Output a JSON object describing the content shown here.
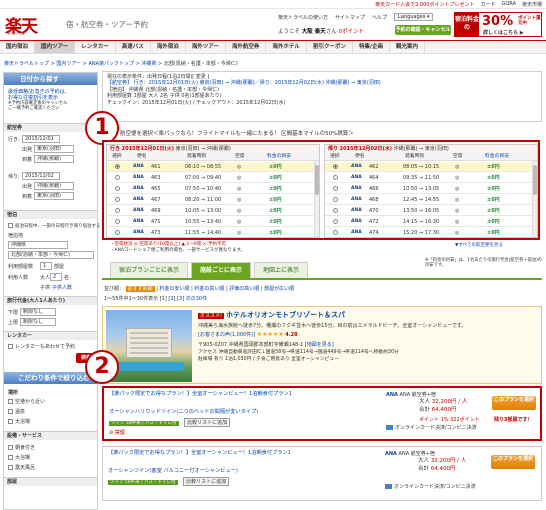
{
  "topbar": {
    "links": [
      "楽天カード入会で2,000ポイントプレゼント",
      "カード",
      "GORA",
      "楽天市場"
    ]
  },
  "header": {
    "logo": "楽天",
    "logo_sub": "トラベル",
    "tagline": "宿・航空券・ツアー予約",
    "links": [
      "楽天トラベルの使い方",
      "サイトマップ",
      "ヘルプ",
      "Languages ▾"
    ],
    "greeting_prefix": "ようこそ",
    "user_name": "大阪 楽天",
    "greeting_suffix": "さん",
    "points": "0ポイント",
    "reserve_button": "予約の確認・キャンセル",
    "campaign": {
      "label": "宿泊料金の",
      "percent": "30%",
      "suffix": "ポイント還元中",
      "detail": "詳しくはこちら ▶"
    }
  },
  "nav": {
    "items": [
      "国内宿泊",
      "国内ツアー",
      "レンタカー",
      "高速バス",
      "海外宿泊",
      "海外ツアー",
      "海外航空券",
      "海外ホテル",
      "割引クーポン",
      "特集/企画",
      "観光案内"
    ],
    "active": 1
  },
  "breadcrumb": [
    "楽天トラベルトップ",
    "国内ツアー",
    "ANA楽パックトップ",
    "沖縄県",
    "北部(恩納・名護・本部・今帰仁)"
  ],
  "sidebar": {
    "title": "日付から探す",
    "promo": [
      "最低価格/お急ぎの予約は、",
      "お得な往復割引を表示",
      "※予約内容確定後のキャンセル",
      "ご一緒予約ご確認ください"
    ],
    "depart_section": "航空券",
    "outbound_label": "行き:",
    "outbound_date": "2015/12/01",
    "depart_from_label": "出発",
    "depart_from": "東京(羽田)",
    "arrive_label": "到着",
    "arrive_to": "沖縄(那覇)",
    "return_label": "帰り:",
    "return_date": "2015/12/02",
    "return_from": "沖縄(那覇)",
    "return_to": "東京(羽田)",
    "hotel_section": "宿泊",
    "hotel_check": "宿泊日程中、一部の日程行き帰り宿泊する",
    "hotel_area_label": "宿泊地",
    "hotel_pref": "沖縄県",
    "hotel_area": "北部(恩納・本部・今帰仁)",
    "rooms_label": "利用部屋数",
    "rooms_value": "1",
    "rooms_unit": "部屋",
    "guests_label": "利用人数",
    "adults_label": "大人",
    "adults_value": "2",
    "adults_unit": "名",
    "child_label": "子供",
    "child_link": "子供人数",
    "travelers_label": "旅行代金(大人1人あたり)",
    "min_label": "下限",
    "min_value": "制限なし",
    "max_label": "上限",
    "max_value": "制限なし",
    "rental_section": "レンタカー",
    "rental_check": "レンタカーもあわせて予約",
    "search_button": "検索",
    "refine_title": "こだわり条件で絞り込む",
    "refine_items": [
      "場所",
      "空港から近い",
      "温泉",
      "大浴場"
    ],
    "facility_title": "設備・サービス",
    "facility_items": [
      "朝食付き",
      "大浴場",
      "露天風呂"
    ],
    "room_title": "部屋"
  },
  "conditions": {
    "lines": [
      "現在の表示条件：出発日程(1泊2日間)[ 変更 ]",
      "【航空券】 行き：2015年12月01日(火) 東京(羽田) ⇒ 沖縄(那覇)／帰り：2015年12月02日(水) 沖縄(那覇) ⇒ 東京(羽田)",
      "【宿泊】 沖縄県 北部(恩納・名護・本部・今帰仁)",
      "利用部屋数 1部屋 大人 2名 子供 0名(1部屋あたり)",
      "チェックイン：2015年12月01日(火) / チェックアウト：2015年12月02日(水)"
    ],
    "change_link": "[ 変更 ]"
  },
  "flight_label": "航空便を選択＜楽パックなら！フライトマイルも一緒にたまる！ 区間基本マイルの50%積算＞",
  "outbound": {
    "header_prefix": "行き",
    "date": "2015年12月01日(火)",
    "route": "東京(羽田) ⇒ 沖縄(那覇)",
    "columns": [
      "選択",
      "便名",
      "発着時刻",
      "空席",
      "料金の目安"
    ],
    "rows": [
      {
        "flight": "461",
        "time": "06:10 ⇒ 08:55",
        "seat": "◎",
        "fee": "±0円",
        "sel": true
      },
      {
        "flight": "463",
        "time": "07:00 ⇒ 09:40",
        "seat": "◎",
        "fee": "±0円",
        "sel": false
      },
      {
        "flight": "465",
        "time": "07:50 ⇒ 10:40",
        "seat": "◎",
        "fee": "±0円",
        "sel": false
      },
      {
        "flight": "467",
        "time": "08:20 ⇒ 11:00",
        "seat": "◎",
        "fee": "±0円",
        "sel": false
      },
      {
        "flight": "469",
        "time": "10:05 ⇒ 13:00",
        "seat": "◎",
        "fee": "±0円",
        "sel": false
      },
      {
        "flight": "471",
        "time": "10:55 ⇒ 13:40",
        "seat": "◎",
        "fee": "±0円",
        "sel": false
      },
      {
        "flight": "473",
        "time": "11:55 ⇒ 14:40",
        "seat": "◎",
        "fee": "±0円",
        "sel": false
      }
    ]
  },
  "return": {
    "header_prefix": "帰り",
    "date": "2015年12月02日(水)",
    "route": "沖縄(那覇) ⇒ 東京(羽田)",
    "columns": [
      "選択",
      "便名",
      "発着時刻",
      "空席",
      "料金の目安"
    ],
    "rows": [
      {
        "flight": "462",
        "time": "08:05 ⇒ 10:15",
        "seat": "◎",
        "fee": "±0円",
        "sel": true
      },
      {
        "flight": "464",
        "time": "09:35 ⇒ 11:50",
        "seat": "◎",
        "fee": "±0円",
        "sel": false
      },
      {
        "flight": "466",
        "time": "10:50 ⇒ 13:05",
        "seat": "◎",
        "fee": "±0円",
        "sel": false
      },
      {
        "flight": "468",
        "time": "12:45 ⇒ 14:55",
        "seat": "◎",
        "fee": "±0円",
        "sel": false
      },
      {
        "flight": "470",
        "time": "13:50 ⇒ 16:05",
        "seat": "◎",
        "fee": "±0円",
        "sel": false
      },
      {
        "flight": "472",
        "time": "14:15 ⇒ 16:30",
        "seat": "◎",
        "fee": "±0円",
        "sel": false
      },
      {
        "flight": "474",
        "time": "15:20 ⇒ 17:30",
        "seat": "◎",
        "fee": "±0円",
        "sel": false
      }
    ]
  },
  "flight_notes": [
    "・空席状況 ◎:空席あり(10席以上) ▲:1〜9席 ×:予約不可",
    "・ANAコードシェア便ご利用の場合、一部サービスが異なります。"
  ],
  "flight_notes_right": "▼すべての航空便を見る",
  "markers": {
    "one": "1",
    "two": "2"
  },
  "tabs": {
    "items": [
      "宿泊プランごとに表示",
      "施設ごとに表示",
      "地図上に表示"
    ],
    "active": 1
  },
  "tabs_note": "※「料金の目安」は、1名あたりの旅行代金(航空券＋宿泊)の目安です。",
  "count_line": {
    "prefix": "並び順：",
    "items": [
      "おすすめ順",
      "料金の安い順",
      "料金の高い順",
      "評価の高い順",
      "部屋が広い順"
    ]
  },
  "page_line": {
    "text": "1〜55件中1〜30件表示",
    "pages": [
      "1",
      "2",
      "3",
      "次の30件"
    ]
  },
  "hotel": {
    "tag": "オススメ!",
    "name": "ホテルオリオンモトブリゾート＆スパ",
    "desc": "沖縄美ら海水族館へ徒歩7分。備瀬のフクギ並木へ徒歩15分。目の前はエメラルドビーチ。全室オーシャンビューです。",
    "rating_label": "[お客さまの声(1,000件)]",
    "stars": "★★★★★",
    "score": "4.28",
    "address": "〒905-0207 沖縄県国頭郡本部町字備瀬148-1",
    "map": "[地図を見る]",
    "access1": "アクセス 沖縄自動車道許田IC↓国道58号→県道114号→国道449号→県道114号へ移動約30分",
    "access2": "駐車場 有り 1泊1,030円 / 夕食ご用意あり 全室オーシャンビュー"
  },
  "plans": [
    {
      "title": "【楽パック限定でお得なプラン！】全室オーシャンビュー！1泊朝食付プラン1",
      "subtitle": "オーシャンハリウッドツイン(二つのベッドの間隔が変いタイプ)",
      "tags": "ツイン 50平米 / バス・トイレ付",
      "compare": "比較リストに追加",
      "policy": "禁煙",
      "airline": "ANA 航空券+宿",
      "price_lines": [
        {
          "label": "大人",
          "value": "32,200円 / 人"
        },
        {
          "label": "合計",
          "value": "64,400円"
        }
      ],
      "points": "ポイント 1% 322ポイント",
      "credit": "オンラインカード決済/コンビニ決済",
      "button": "このプランを選択",
      "remaining": "残り3部屋です！"
    },
    {
      "title": "【楽パック限定でお得なプラン！】全室オーシャンビュー！1泊朝食付プラン1",
      "subtitle": "オーシャンツイン(客室 バルコニー付オーシャンビュー)",
      "tags": "ツイン 50平米 / バス・トイレ付",
      "compare": "比較リストに追加",
      "airline": "ANA 航空券+宿",
      "price_lines": [
        {
          "label": "大人",
          "value": "32,200円 / 人"
        },
        {
          "label": "合計",
          "value": "64,400円"
        }
      ],
      "credit": "オンラインカード決済/コンビニ決済",
      "button": "このプランを選択"
    }
  ]
}
